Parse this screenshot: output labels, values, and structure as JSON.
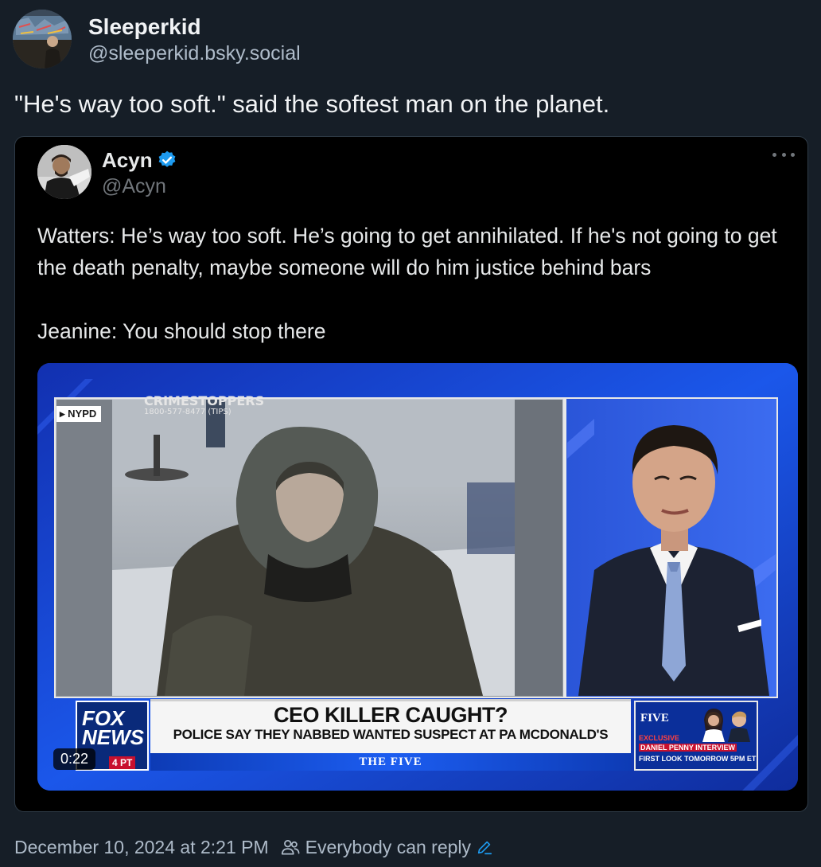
{
  "post": {
    "author": {
      "display_name": "Sleeperkid",
      "handle": "@sleeperkid.bsky.social",
      "avatar_icon": "avatar-graffiti"
    },
    "text": "\"He's way too soft.\" said the softest man on the planet.",
    "timestamp": "December 10, 2024 at 2:21 PM",
    "reply_setting": "Everybody can reply",
    "reply_icon": "people-icon",
    "edit_icon": "pencil-icon"
  },
  "quote": {
    "author": {
      "display_name": "Acyn",
      "handle": "@Acyn",
      "verified": true,
      "verified_color": "#1d9bf0"
    },
    "more_icon": "more-icon",
    "paragraphs": [
      "Watters: He’s way too soft. He’s going to get annihilated. If he's not going to get the death penalty, maybe someone will do him justice behind bars",
      "Jeanine: You should stop there"
    ],
    "video": {
      "duration": "0:22",
      "overlay": {
        "nypd_tag": "▸ NYPD",
        "crime_stoppers_title": "CRIMESTOPPERS",
        "crime_stoppers_phone": "1800-577-8477 (TIPS)",
        "network_line1": "FOX",
        "network_line2": "NEWS",
        "network_time": "4 PT",
        "headline": "CEO KILLER CAUGHT?",
        "subhead": "POLICE SAY THEY NABBED WANTED SUSPECT AT PA MCDONALD'S",
        "show_bar": "THE FIVE",
        "promo_show": "FIVE",
        "promo_exclusive": "EXCLUSIVE",
        "promo_line1": "DANIEL PENNY INTERVIEW",
        "promo_line2": "FIRST LOOK TOMORROW 5PM ET"
      }
    }
  },
  "colors": {
    "background": "#161e27",
    "quote_background": "#000000",
    "secondary_text": "#aebbc9",
    "accent": "#1d9bf0"
  }
}
